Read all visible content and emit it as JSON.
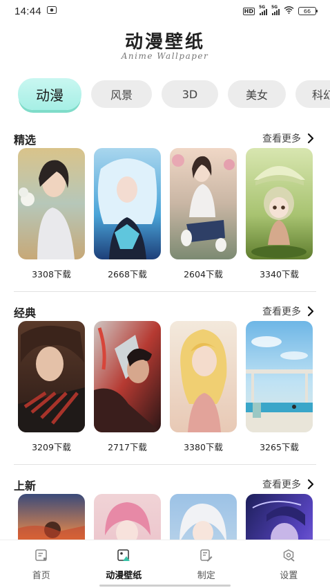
{
  "status_bar": {
    "time": "14:44",
    "hd": "HD",
    "sim1": "5G",
    "sim2": "5G",
    "battery": "66"
  },
  "header": {
    "title": "动漫壁纸",
    "subtitle": "Anime Wallpaper"
  },
  "tabs": [
    "动漫",
    "风景",
    "3D",
    "美女",
    "科幻"
  ],
  "sections": [
    {
      "title": "精选",
      "more": "查看更多",
      "items": [
        {
          "downloads": "3308下载"
        },
        {
          "downloads": "2668下载"
        },
        {
          "downloads": "2604下载"
        },
        {
          "downloads": "3340下载"
        }
      ]
    },
    {
      "title": "经典",
      "more": "查看更多",
      "items": [
        {
          "downloads": "3209下载"
        },
        {
          "downloads": "2717下载"
        },
        {
          "downloads": "3380下载"
        },
        {
          "downloads": "3265下载"
        }
      ]
    },
    {
      "title": "上新",
      "more": "查看更多",
      "items": []
    }
  ],
  "bottom_nav": [
    {
      "label": "首页",
      "icon": "home-icon"
    },
    {
      "label": "动漫壁纸",
      "icon": "wallpaper-icon"
    },
    {
      "label": "制定",
      "icon": "customize-icon"
    },
    {
      "label": "设置",
      "icon": "settings-icon"
    }
  ],
  "colors": {
    "active_tab": "#a6efe5",
    "accent_underline": "#7fdcc9"
  }
}
